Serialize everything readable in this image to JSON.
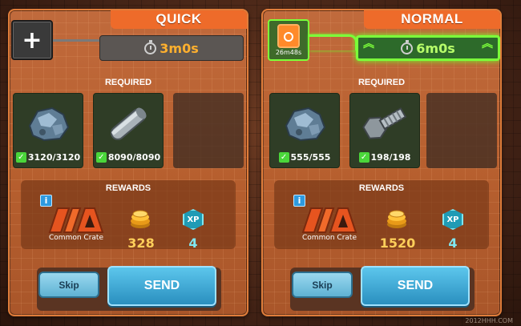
{
  "quick": {
    "title": "QUICK",
    "add_label": "+",
    "time": "3m0s",
    "required_label": "REQUIRED",
    "items": [
      {
        "name": "ore-icon",
        "qty": "3120/3120"
      },
      {
        "name": "metal-bar-icon",
        "qty": "8090/8090"
      }
    ],
    "rewards_label": "REWARDS",
    "crate_label": "Common Crate",
    "coins": "328",
    "xp_label": "XP",
    "xp": "4",
    "skip_label": "Skip",
    "send_label": "SEND"
  },
  "normal": {
    "title": "NORMAL",
    "boost_time": "26m48s",
    "time": "6m0s",
    "required_label": "REQUIRED",
    "items": [
      {
        "name": "ore-icon",
        "qty": "555/555"
      },
      {
        "name": "bolt-icon",
        "qty": "198/198"
      }
    ],
    "rewards_label": "REWARDS",
    "crate_label": "Common Crate",
    "coins": "1520",
    "xp_label": "XP",
    "xp": "4",
    "skip_label": "Skip",
    "send_label": "SEND"
  },
  "info_glyph": "i",
  "check_glyph": "✓",
  "chevron_glyph": "︽",
  "watermark": "2012HHH.COM",
  "colors": {
    "accent_orange": "#ee6b2a",
    "time_gold": "#ffb02e",
    "boost_green": "#7cff3a",
    "send_blue": "#2a8fbf"
  }
}
